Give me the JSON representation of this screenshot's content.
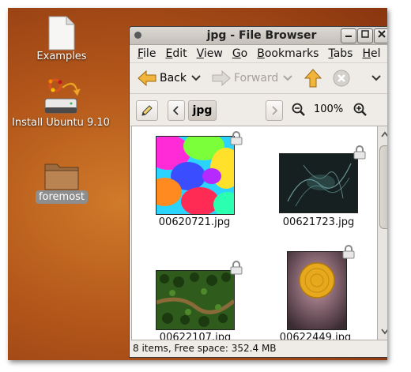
{
  "desktop": {
    "icons": [
      {
        "label": "Examples",
        "icon": "document-icon"
      },
      {
        "label": "Install Ubuntu 9.10",
        "icon": "installer-drive-icon"
      },
      {
        "label": "foremost",
        "icon": "folder-icon"
      }
    ]
  },
  "window": {
    "title": "jpg - File Browser",
    "menu": [
      "File",
      "Edit",
      "View",
      "Go",
      "Bookmarks",
      "Tabs",
      "Hel"
    ],
    "toolbar": {
      "back_label": "Back",
      "forward_label": "Forward"
    },
    "location": {
      "current_folder": "jpg",
      "zoom": "100%"
    },
    "files": [
      {
        "name": "00620721.jpg"
      },
      {
        "name": "00621723.jpg"
      },
      {
        "name": "00622107.jpg"
      },
      {
        "name": "00622449.jpg"
      }
    ],
    "status": "8 items, Free space: 352.4 MB"
  },
  "colors": {
    "desktop": "#b2561a",
    "window_bg": "#efebe7",
    "up_arrow": "#f0b53a"
  }
}
